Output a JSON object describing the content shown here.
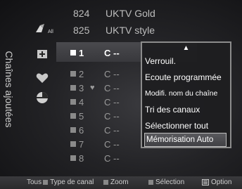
{
  "sidebar": {
    "title": "Chaînes ajoutées"
  },
  "icons": {
    "all_label": "All"
  },
  "top_channels": [
    {
      "number": "824",
      "name": "UKTV Gold"
    },
    {
      "number": "825",
      "name": "UKTV style"
    }
  ],
  "added_channels": [
    {
      "number": "1",
      "name": "C --",
      "selected": true,
      "fav": false
    },
    {
      "number": "2",
      "name": "C --",
      "selected": false,
      "fav": false
    },
    {
      "number": "3",
      "name": "C --",
      "selected": false,
      "fav": true
    },
    {
      "number": "4",
      "name": "C --",
      "selected": false,
      "fav": false
    },
    {
      "number": "5",
      "name": "C --",
      "selected": false,
      "fav": false
    },
    {
      "number": "6",
      "name": "C --",
      "selected": false,
      "fav": false
    },
    {
      "number": "7",
      "name": "C --",
      "selected": false,
      "fav": false
    },
    {
      "number": "8",
      "name": "C --",
      "selected": false,
      "fav": false
    }
  ],
  "heart_glyph": "♥",
  "option_menu": {
    "up_arrow": "▲",
    "items": [
      "Verrouil.",
      "Ecoute programmée",
      "Modifi. nom du chaîne",
      "Tri des canaux",
      "Sélectionner tout",
      "Mémorisation Auto"
    ],
    "highlighted_index": 5
  },
  "bottom_bar": {
    "channel_type_prefix": "Tous",
    "channel_type_label": "Type de canal",
    "zoom_label": "Zoom",
    "select_label": "Sélection",
    "option_label": "Option"
  }
}
